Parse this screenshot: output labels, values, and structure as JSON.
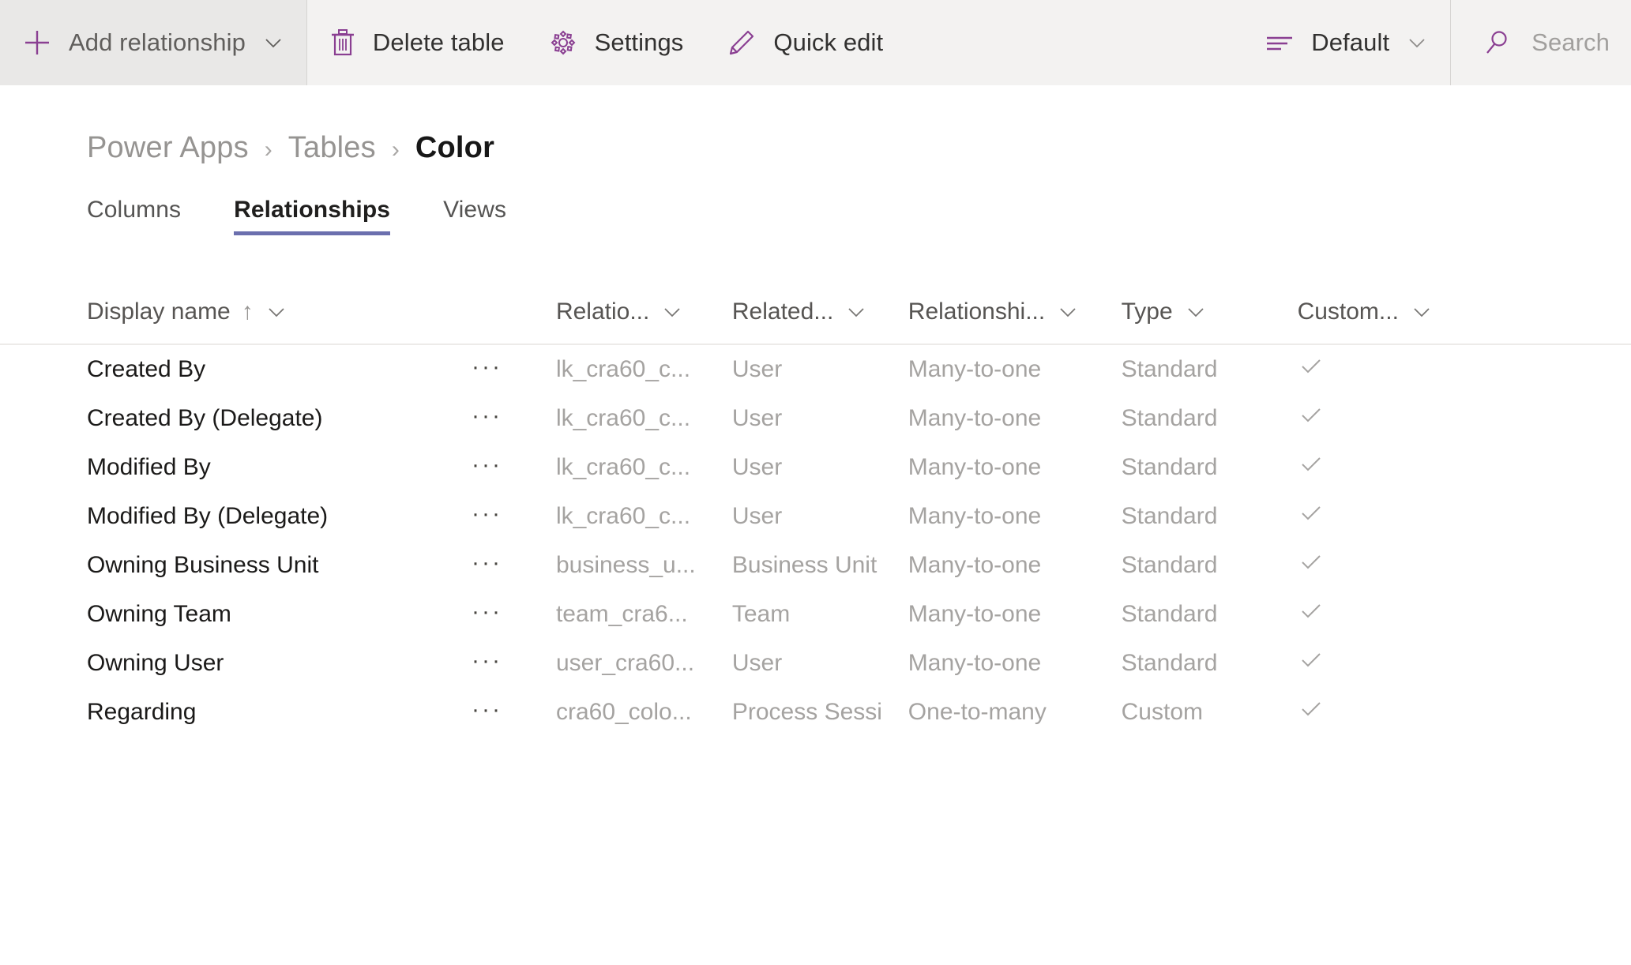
{
  "toolbar": {
    "add_relationship": {
      "label": "Add relationship",
      "icon": "plus-icon",
      "chevron": "chevron-down-icon"
    },
    "delete_table": {
      "label": "Delete table",
      "icon": "trash-icon"
    },
    "settings": {
      "label": "Settings",
      "icon": "gear-icon"
    },
    "quick_edit": {
      "label": "Quick edit",
      "icon": "pencil-icon"
    },
    "view_selector": {
      "label": "Default",
      "icon": "list-lines-icon",
      "chevron": "chevron-down-icon"
    },
    "search": {
      "placeholder": "Search",
      "icon": "search-icon"
    }
  },
  "breadcrumb": {
    "items": [
      {
        "label": "Power Apps",
        "current": false
      },
      {
        "label": "Tables",
        "current": false
      },
      {
        "label": "Color",
        "current": true
      }
    ],
    "separator": "›"
  },
  "tabs": [
    {
      "label": "Columns",
      "active": false
    },
    {
      "label": "Relationships",
      "active": true
    },
    {
      "label": "Views",
      "active": false
    }
  ],
  "table": {
    "columns": [
      {
        "label": "Display name",
        "sorted": true,
        "sort_arrow": "↑",
        "chevron": "chevron-down-icon"
      },
      {
        "label": "Relatio...",
        "sorted": false,
        "chevron": "chevron-down-icon"
      },
      {
        "label": "Related...",
        "sorted": false,
        "chevron": "chevron-down-icon"
      },
      {
        "label": "Relationshi...",
        "sorted": false,
        "chevron": "chevron-down-icon"
      },
      {
        "label": "Type",
        "sorted": false,
        "chevron": "chevron-down-icon"
      },
      {
        "label": "Custom...",
        "sorted": false,
        "chevron": "chevron-down-icon"
      }
    ],
    "row_menu_glyph": "···",
    "check_glyph": "check-icon",
    "rows": [
      {
        "display_name": "Created By",
        "relationship_name": "lk_cra60_c...",
        "related_table": "User",
        "relationship_type": "Many-to-one",
        "type": "Standard",
        "customizable": true
      },
      {
        "display_name": "Created By (Delegate)",
        "relationship_name": "lk_cra60_c...",
        "related_table": "User",
        "relationship_type": "Many-to-one",
        "type": "Standard",
        "customizable": true
      },
      {
        "display_name": "Modified By",
        "relationship_name": "lk_cra60_c...",
        "related_table": "User",
        "relationship_type": "Many-to-one",
        "type": "Standard",
        "customizable": true
      },
      {
        "display_name": "Modified By (Delegate)",
        "relationship_name": "lk_cra60_c...",
        "related_table": "User",
        "relationship_type": "Many-to-one",
        "type": "Standard",
        "customizable": true
      },
      {
        "display_name": "Owning Business Unit",
        "relationship_name": "business_u...",
        "related_table": "Business Unit",
        "relationship_type": "Many-to-one",
        "type": "Standard",
        "customizable": true
      },
      {
        "display_name": "Owning Team",
        "relationship_name": "team_cra6...",
        "related_table": "Team",
        "relationship_type": "Many-to-one",
        "type": "Standard",
        "customizable": true
      },
      {
        "display_name": "Owning User",
        "relationship_name": "user_cra60...",
        "related_table": "User",
        "relationship_type": "Many-to-one",
        "type": "Standard",
        "customizable": true
      },
      {
        "display_name": "Regarding",
        "relationship_name": "cra60_colo...",
        "related_table": "Process Sessi",
        "relationship_type": "One-to-many",
        "type": "Custom",
        "customizable": true
      }
    ]
  },
  "colors": {
    "accent_purple": "#8A3F92",
    "tab_underline": "#6b6fae",
    "toolbar_bg": "#f3f2f1",
    "toolbar_highlight": "#e9e8e7",
    "text_primary": "#1b1a19",
    "text_muted": "#a5a3a1"
  }
}
